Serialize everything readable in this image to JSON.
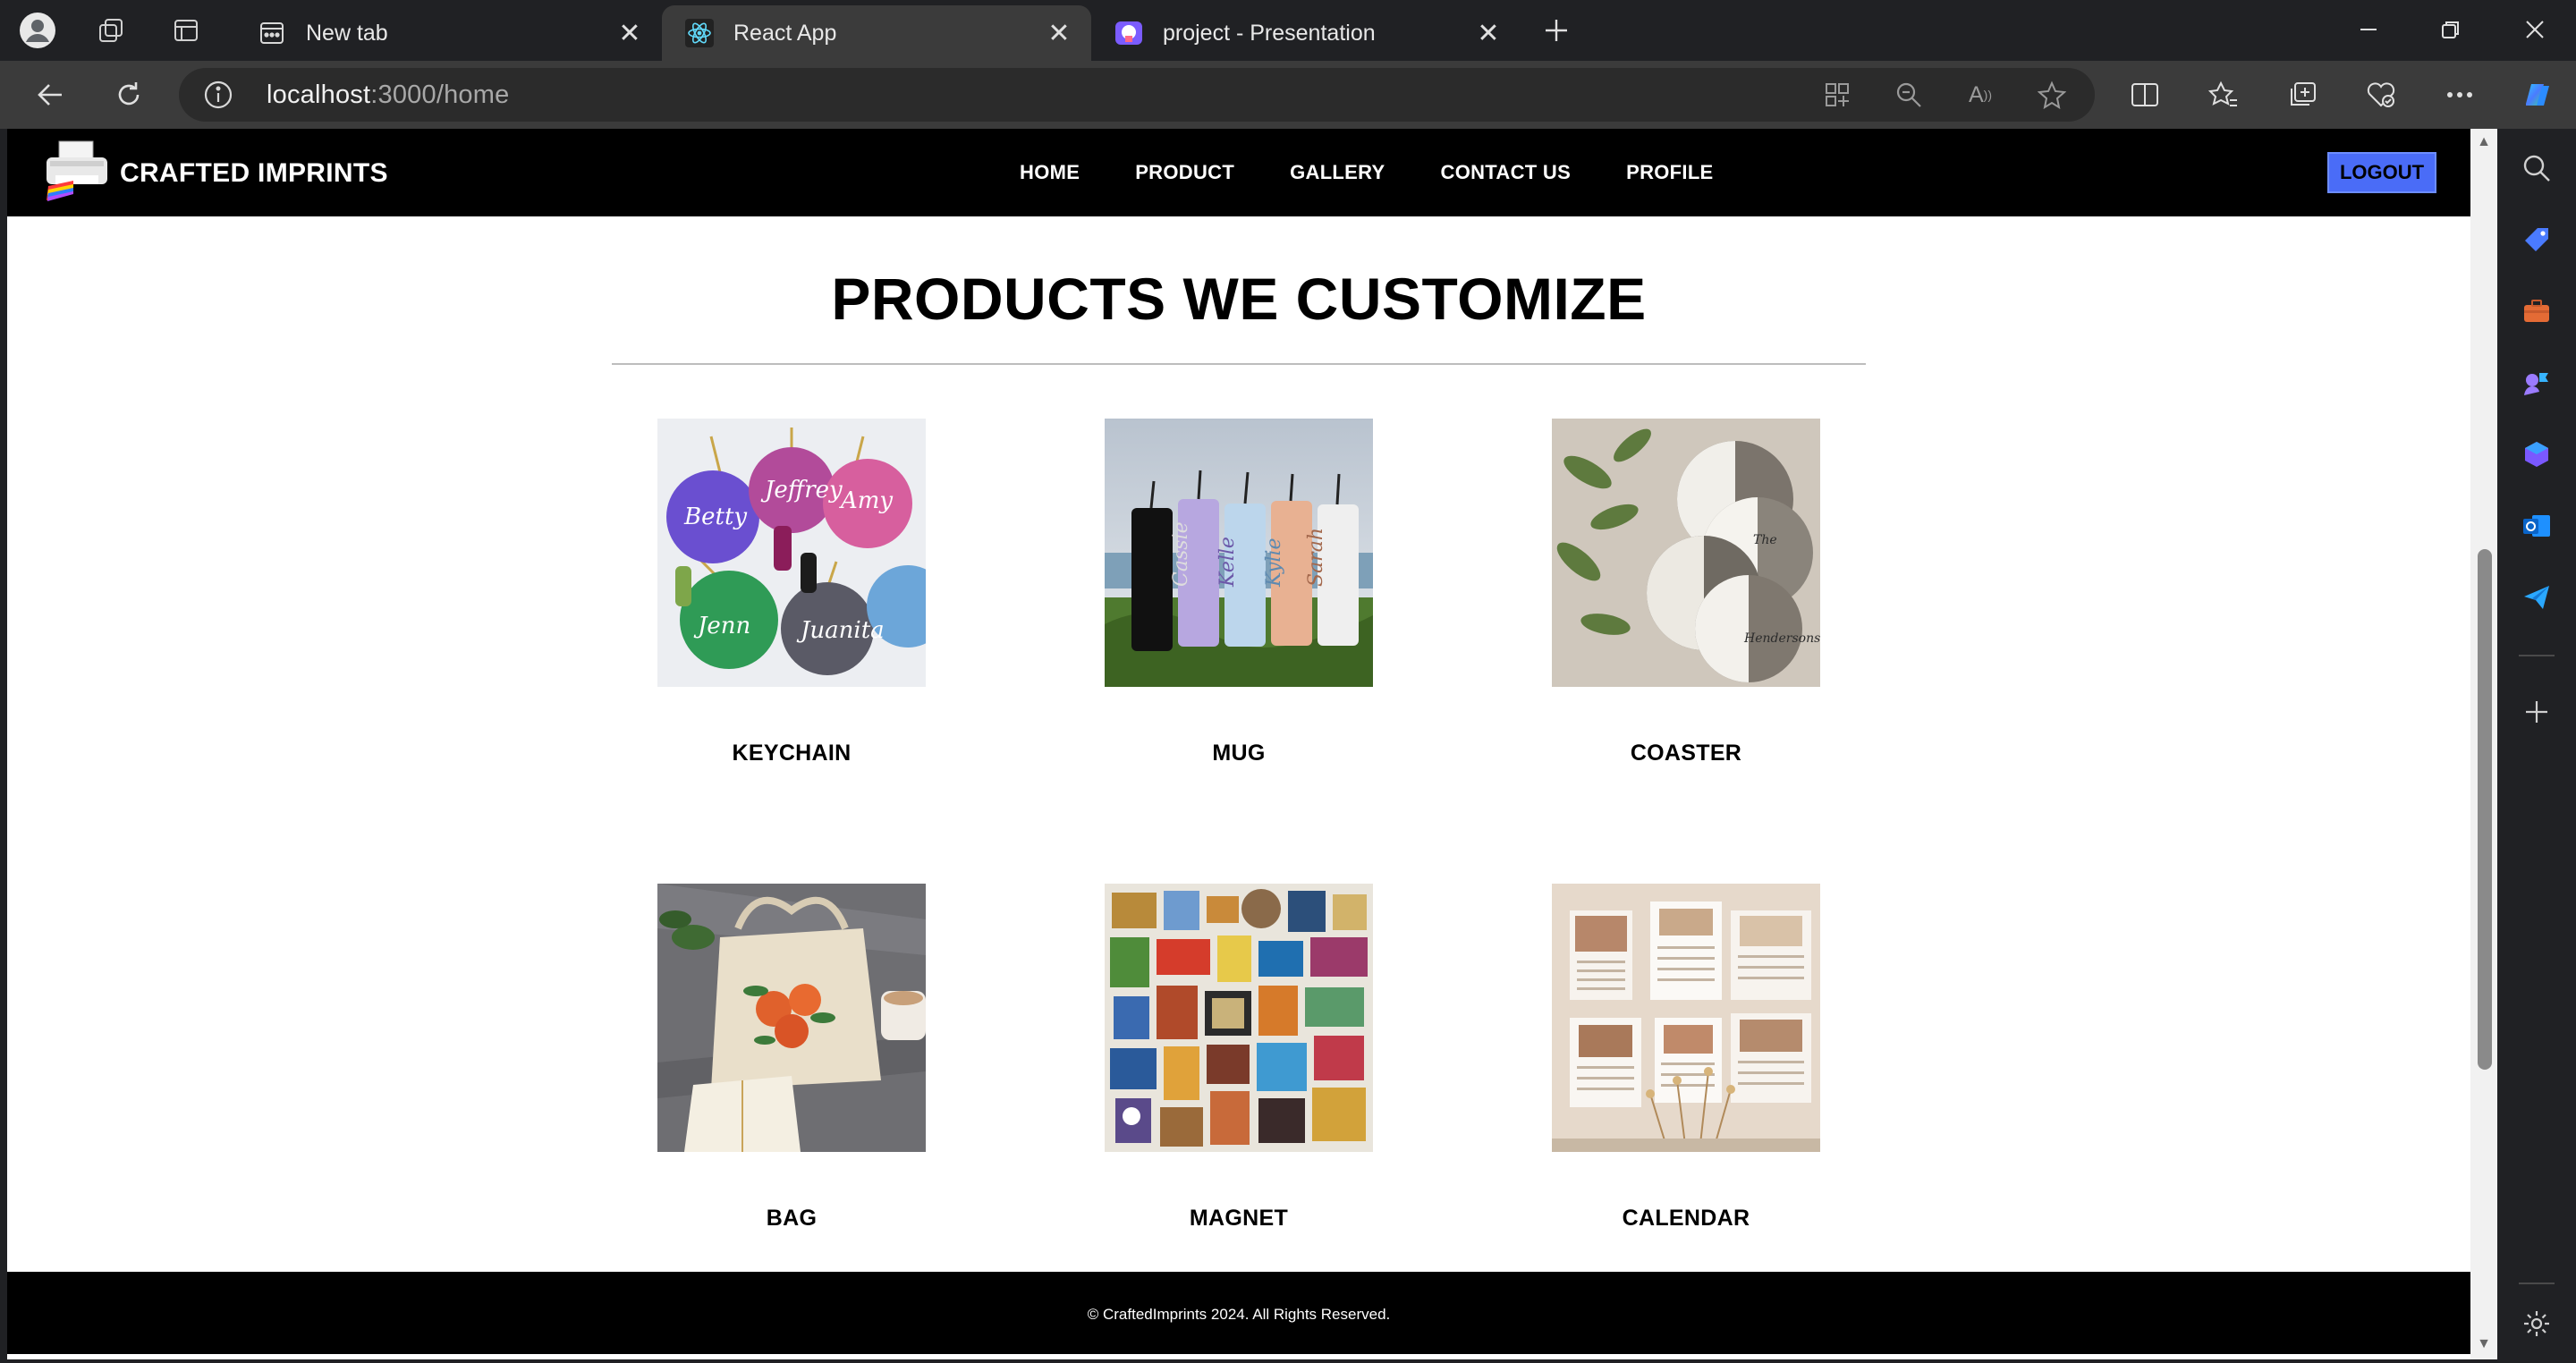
{
  "browser": {
    "tabs": [
      {
        "title": "New tab",
        "active": false
      },
      {
        "title": "React App",
        "active": true
      },
      {
        "title": "project - Presentation",
        "active": false
      }
    ],
    "address": {
      "host": "localhost",
      "rest": ":3000/home"
    }
  },
  "site": {
    "brand": "CRAFTED IMPRINTS",
    "nav": [
      "HOME",
      "PRODUCT",
      "GALLERY",
      "CONTACT US",
      "PROFILE"
    ],
    "logout_label": "LOGOUT"
  },
  "section": {
    "title": "PRODUCTS WE CUSTOMIZE",
    "products": [
      {
        "name": "KEYCHAIN",
        "image": "keychain-photo"
      },
      {
        "name": "MUG",
        "image": "tumblers-photo"
      },
      {
        "name": "COASTER",
        "image": "coasters-photo"
      },
      {
        "name": "BAG",
        "image": "tote-bag-photo"
      },
      {
        "name": "MAGNET",
        "image": "fridge-magnets-photo"
      },
      {
        "name": "CALENDAR",
        "image": "calendar-photo"
      }
    ]
  },
  "footer": {
    "copyright": "© CraftedImprints 2024. All Rights Reserved."
  }
}
